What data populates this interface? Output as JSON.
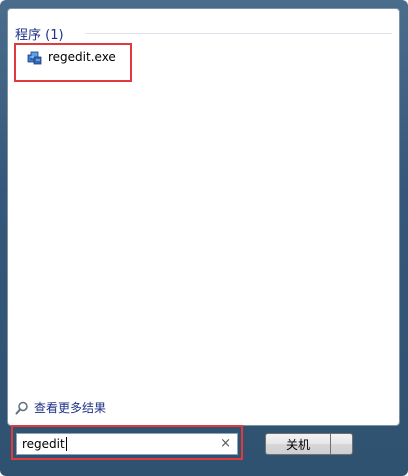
{
  "results": {
    "section_title": "程序 (1)",
    "items": [
      {
        "label": "regedit.exe",
        "icon": "registry-editor-icon"
      }
    ]
  },
  "see_more": {
    "label": "查看更多结果",
    "icon": "magnifier-icon"
  },
  "search": {
    "value": "regedit",
    "clear_glyph": "×"
  },
  "shutdown": {
    "label": "关机"
  },
  "colors": {
    "highlight": "#e03a3e",
    "link": "#1e3287",
    "frame": "#35587a"
  }
}
